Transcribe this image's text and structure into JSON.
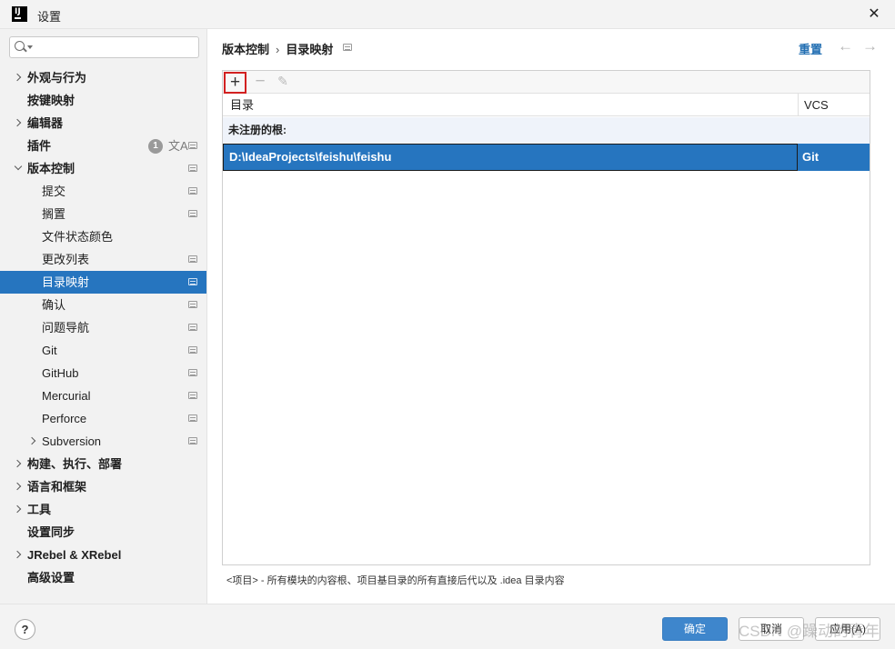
{
  "window": {
    "title": "设置",
    "app_icon": "IJ",
    "close_icon": "✕"
  },
  "sidebar": {
    "search": {
      "value": "",
      "placeholder": ""
    },
    "items": [
      {
        "label": "外观与行为",
        "expandable": true
      },
      {
        "label": "按键映射"
      },
      {
        "label": "编辑器",
        "expandable": true
      },
      {
        "label": "插件",
        "badge": "1"
      },
      {
        "label": "版本控制",
        "expanded": true
      },
      {
        "label": "提交"
      },
      {
        "label": "搁置"
      },
      {
        "label": "文件状态颜色"
      },
      {
        "label": "更改列表"
      },
      {
        "label": "目录映射",
        "selected": true
      },
      {
        "label": "确认"
      },
      {
        "label": "问题导航"
      },
      {
        "label": "Git"
      },
      {
        "label": "GitHub"
      },
      {
        "label": "Mercurial"
      },
      {
        "label": "Perforce"
      },
      {
        "label": "Subversion",
        "expandable": true
      },
      {
        "label": "构建、执行、部署",
        "expandable": true
      },
      {
        "label": "语言和框架",
        "expandable": true
      },
      {
        "label": "工具",
        "expandable": true
      },
      {
        "label": "设置同步"
      },
      {
        "label": "JRebel & XRebel",
        "expandable": true
      },
      {
        "label": "高级设置"
      }
    ]
  },
  "header": {
    "breadcrumb": [
      "版本控制",
      "目录映射"
    ],
    "breadcrumb_sep": "›",
    "reset_label": "重置",
    "back_icon": "←",
    "forward_icon": "→"
  },
  "toolbar": {
    "add_icon": "+",
    "remove_icon": "−",
    "edit_icon": "✎"
  },
  "table": {
    "columns": [
      "目录",
      "VCS"
    ],
    "group_label": "未注册的根:",
    "rows": [
      {
        "directory": "D:\\IdeaProjects\\feishu\\feishu",
        "vcs": "Git"
      }
    ]
  },
  "hint": "<项目> - 所有模块的内容根、项目基目录的所有直接后代以及 .idea 目录内容",
  "footer": {
    "help_icon": "?",
    "ok_label": "确定",
    "cancel_label": "取消",
    "apply_label": "应用(A)"
  },
  "watermark": "CSDN @躁动的青年",
  "colors": {
    "accent": "#2675bf",
    "link": "#2470b3",
    "highlight_border": "#d22020"
  }
}
